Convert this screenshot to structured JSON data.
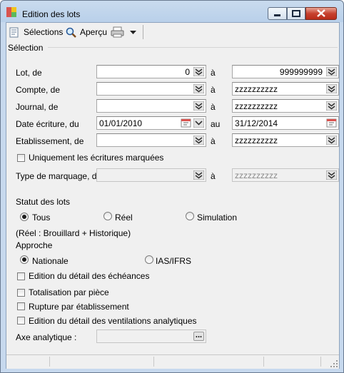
{
  "window": {
    "title": "Edition des lots"
  },
  "toolbar": {
    "selections_label": "Sélections",
    "apercu_label": "Aperçu"
  },
  "section": {
    "selection_label": "Sélection"
  },
  "filters": {
    "lot": {
      "label": "Lot, de",
      "from": "0",
      "to_label": "à",
      "to": "999999999"
    },
    "compte": {
      "label": "Compte, de",
      "from": "",
      "to_label": "à",
      "to": "zzzzzzzzzz"
    },
    "journal": {
      "label": "Journal, de",
      "from": "",
      "to_label": "à",
      "to": "zzzzzzzzzz"
    },
    "date": {
      "label": "Date écriture, du",
      "from": "01/01/2010",
      "to_label": "au",
      "to": "31/12/2014"
    },
    "etablissement": {
      "label": "Etablissement, de",
      "from": "",
      "to_label": "à",
      "to": "zzzzzzzzzz"
    }
  },
  "uniquement_marquees": {
    "label": "Uniquement les écritures marquées",
    "checked": false
  },
  "type_marquage": {
    "label": "Type de marquage, de",
    "from": "",
    "to_label": "à",
    "to": "zzzzzzzzzz"
  },
  "statut": {
    "label": "Statut des lots",
    "options": [
      "Tous",
      "Réel",
      "Simulation"
    ],
    "selected": "Tous",
    "note": "(Réel : Brouillard + Historique)"
  },
  "approche": {
    "label": "Approche",
    "options": [
      "Nationale",
      "IAS/IFRS"
    ],
    "selected": "Nationale"
  },
  "options": {
    "detail_echeances": "Edition du détail des échéances",
    "totalisation_piece": "Totalisation par pièce",
    "rupture_etablissement": "Rupture par établissement",
    "detail_ventilations": "Edition du détail des ventilations analytiques"
  },
  "axe_analytique": {
    "label": "Axe analytique :",
    "value": "",
    "browse_label": "..."
  },
  "colors": {
    "titlebar": "#b9d0ea",
    "client_bg": "#f0f0f0",
    "close_button": "#c7422f"
  }
}
